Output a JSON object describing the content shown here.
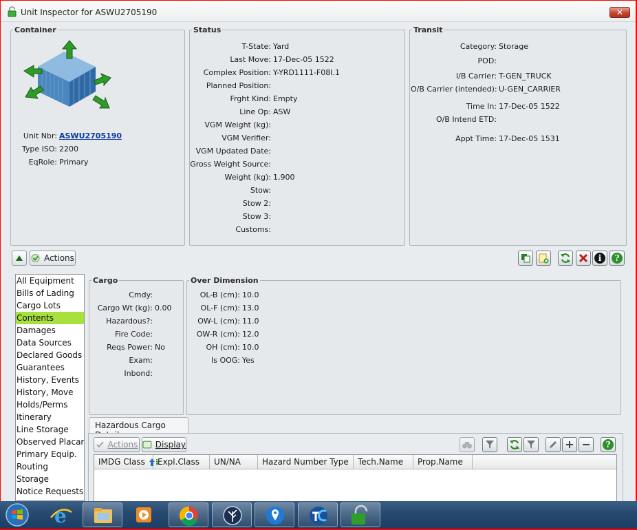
{
  "window": {
    "title": "Unit Inspector for ASWU2705190",
    "close_label": "✕"
  },
  "container": {
    "legend": "Container",
    "fields": [
      {
        "label": "Unit Nbr:",
        "value": "ASWU2705190"
      },
      {
        "label": "Type ISO:",
        "value": "2200"
      },
      {
        "label": "EqRole:",
        "value": "Primary"
      }
    ]
  },
  "status": {
    "legend": "Status",
    "fields": [
      {
        "label": "T-State:",
        "value": "Yard"
      },
      {
        "label": "Last Move:",
        "value": "17-Dec-05 1522"
      },
      {
        "label": "Complex Position:",
        "value": "Y-YRD1111-F08I.1"
      },
      {
        "label": "Planned Position:",
        "value": ""
      },
      {
        "label": "Frght Kind:",
        "value": "Empty"
      },
      {
        "label": "Line Op:",
        "value": "ASW"
      },
      {
        "label": "VGM Weight (kg):",
        "value": ""
      },
      {
        "label": "VGM Verifier:",
        "value": ""
      },
      {
        "label": "VGM Updated Date:",
        "value": ""
      },
      {
        "label": "Gross Weight Source:",
        "value": ""
      },
      {
        "label": "Weight (kg):",
        "value": "1,900"
      },
      {
        "label": "Stow:",
        "value": ""
      },
      {
        "label": "Stow 2:",
        "value": ""
      },
      {
        "label": "Stow 3:",
        "value": ""
      },
      {
        "label": "Customs:",
        "value": ""
      }
    ]
  },
  "transit": {
    "legend": "Transit",
    "fields": [
      {
        "label": "Category:",
        "value": "Storage"
      },
      {
        "label": "POD:",
        "value": ""
      },
      {
        "label": "I/B Carrier:",
        "value": "T-GEN_TRUCK"
      },
      {
        "label": "O/B Carrier (intended):",
        "value": "U-GEN_CARRIER"
      },
      {
        "label": "Time In:",
        "value": "17-Dec-05 1522"
      },
      {
        "label": "O/B Intend ETD:",
        "value": ""
      },
      {
        "label": "Appt Time:",
        "value": "17-Dec-05 1531"
      }
    ]
  },
  "toolbar": {
    "actions_label": "Actions"
  },
  "nav": {
    "items": [
      "All Equipment",
      "Bills of Lading",
      "Cargo Lots",
      "Contents",
      "Damages",
      "Data Sources",
      "Declared Goods",
      "Guarantees",
      "History, Events",
      "History, Move",
      "Holds/Perms",
      "Itinerary",
      "Line Storage",
      "Observed Placards",
      "Primary Equip.",
      "Routing",
      "Storage",
      "Notice Requests"
    ],
    "selected": "Contents"
  },
  "cargo": {
    "legend": "Cargo",
    "fields": [
      {
        "label": "Cmdy:",
        "value": ""
      },
      {
        "label": "Cargo Wt (kg):",
        "value": "0.00"
      },
      {
        "label": "Hazardous?:",
        "value": ""
      },
      {
        "label": "Fire Code:",
        "value": ""
      },
      {
        "label": "Reqs Power:",
        "value": "No"
      },
      {
        "label": "Exam:",
        "value": ""
      },
      {
        "label": "Inbond:",
        "value": ""
      }
    ]
  },
  "over_dimension": {
    "legend": "Over Dimension",
    "fields": [
      {
        "label": "OL-B (cm):",
        "value": "10.0"
      },
      {
        "label": "OL-F (cm):",
        "value": "13.0"
      },
      {
        "label": "OW-L (cm):",
        "value": "11.0"
      },
      {
        "label": "OW-R (cm):",
        "value": "12.0"
      },
      {
        "label": "OH (cm):",
        "value": "10.0"
      },
      {
        "label": "Is OOG:",
        "value": "Yes"
      }
    ]
  },
  "hazard": {
    "tab_label": "Hazardous Cargo Details",
    "actions_label": "Actions",
    "display_label": "Display",
    "columns": [
      "IMDG Class",
      "Expl.Class",
      "UN/NA",
      "Hazard Number Type",
      "Tech.Name",
      "Prop.Name"
    ]
  }
}
